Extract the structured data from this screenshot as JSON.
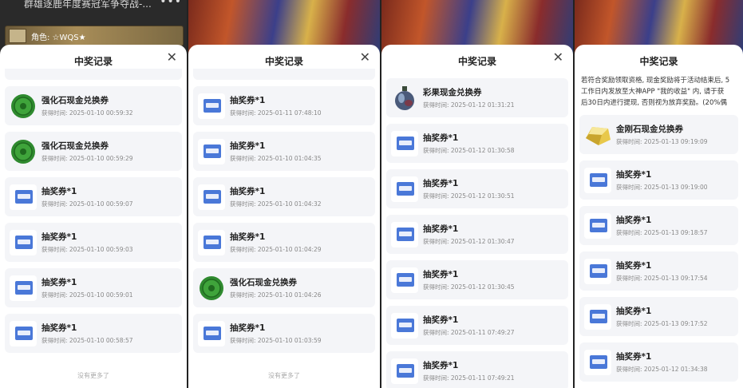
{
  "common": {
    "sheet_title": "中奖记录",
    "close_glyph": "✕",
    "no_more": "没有更多了"
  },
  "panel1": {
    "header_title": "群雄逐鹿年度赛冠军争夺战-...",
    "more_glyph": "•••",
    "role_label": "角色: ☆WQS★",
    "items": [
      {
        "type": "jade",
        "name": "强化石现金兑换券",
        "time": "获得时间: 2025-01-10 00:59:32"
      },
      {
        "type": "jade",
        "name": "强化石现金兑换券",
        "time": "获得时间: 2025-01-10 00:59:29"
      },
      {
        "type": "ticket",
        "name": "抽奖券*1",
        "time": "获得时间: 2025-01-10 00:59:07"
      },
      {
        "type": "ticket",
        "name": "抽奖券*1",
        "time": "获得时间: 2025-01-10 00:59:03"
      },
      {
        "type": "ticket",
        "name": "抽奖券*1",
        "time": "获得时间: 2025-01-10 00:59:01"
      },
      {
        "type": "ticket",
        "name": "抽奖券*1",
        "time": "获得时间: 2025-01-10 00:58:57"
      }
    ]
  },
  "panel2": {
    "items": [
      {
        "type": "ticket",
        "name": "抽奖券*1",
        "time": "获得时间: 2025-01-11 07:48:10"
      },
      {
        "type": "ticket",
        "name": "抽奖券*1",
        "time": "获得时间: 2025-01-10 01:04:35"
      },
      {
        "type": "ticket",
        "name": "抽奖券*1",
        "time": "获得时间: 2025-01-10 01:04:32"
      },
      {
        "type": "ticket",
        "name": "抽奖券*1",
        "time": "获得时间: 2025-01-10 01:04:29"
      },
      {
        "type": "jade",
        "name": "强化石现金兑换券",
        "time": "获得时间: 2025-01-10 01:04:26"
      },
      {
        "type": "ticket",
        "name": "抽奖券*1",
        "time": "获得时间: 2025-01-10 01:03:59"
      }
    ]
  },
  "panel3": {
    "items": [
      {
        "type": "vase",
        "name": "彩果现金兑换券",
        "time": "获得时间: 2025-01-12 01:31:21"
      },
      {
        "type": "ticket",
        "name": "抽奖券*1",
        "time": "获得时间: 2025-01-12 01:30:58"
      },
      {
        "type": "ticket",
        "name": "抽奖券*1",
        "time": "获得时间: 2025-01-12 01:30:51"
      },
      {
        "type": "ticket",
        "name": "抽奖券*1",
        "time": "获得时间: 2025-01-12 01:30:47"
      },
      {
        "type": "ticket",
        "name": "抽奖券*1",
        "time": "获得时间: 2025-01-12 01:30:45"
      },
      {
        "type": "ticket",
        "name": "抽奖券*1",
        "time": "获得时间: 2025-01-11 07:49:27"
      },
      {
        "type": "ticket",
        "name": "抽奖券*1",
        "time": "获得时间: 2025-01-11 07:49:21"
      }
    ]
  },
  "panel4": {
    "notice_lines": [
      "若符合奖励领取资格, 现金奖励将于活动结束后, 5",
      "工作日内发放至大神APP \"我的收益\" 内, 请于获",
      "后30日内进行提现, 否则视为放弃奖励。(20%偶"
    ],
    "items": [
      {
        "type": "gold",
        "name": "金刚石现金兑换券",
        "time": "获得时间: 2025-01-13 09:19:09"
      },
      {
        "type": "ticket",
        "name": "抽奖券*1",
        "time": "获得时间: 2025-01-13 09:19:00"
      },
      {
        "type": "ticket",
        "name": "抽奖券*1",
        "time": "获得时间: 2025-01-13 09:18:57"
      },
      {
        "type": "ticket",
        "name": "抽奖券*1",
        "time": "获得时间: 2025-01-13 09:17:54"
      },
      {
        "type": "ticket",
        "name": "抽奖券*1",
        "time": "获得时间: 2025-01-13 09:17:52"
      },
      {
        "type": "ticket",
        "name": "抽奖券*1",
        "time": "获得时间: 2025-01-12 01:34:38"
      }
    ]
  }
}
